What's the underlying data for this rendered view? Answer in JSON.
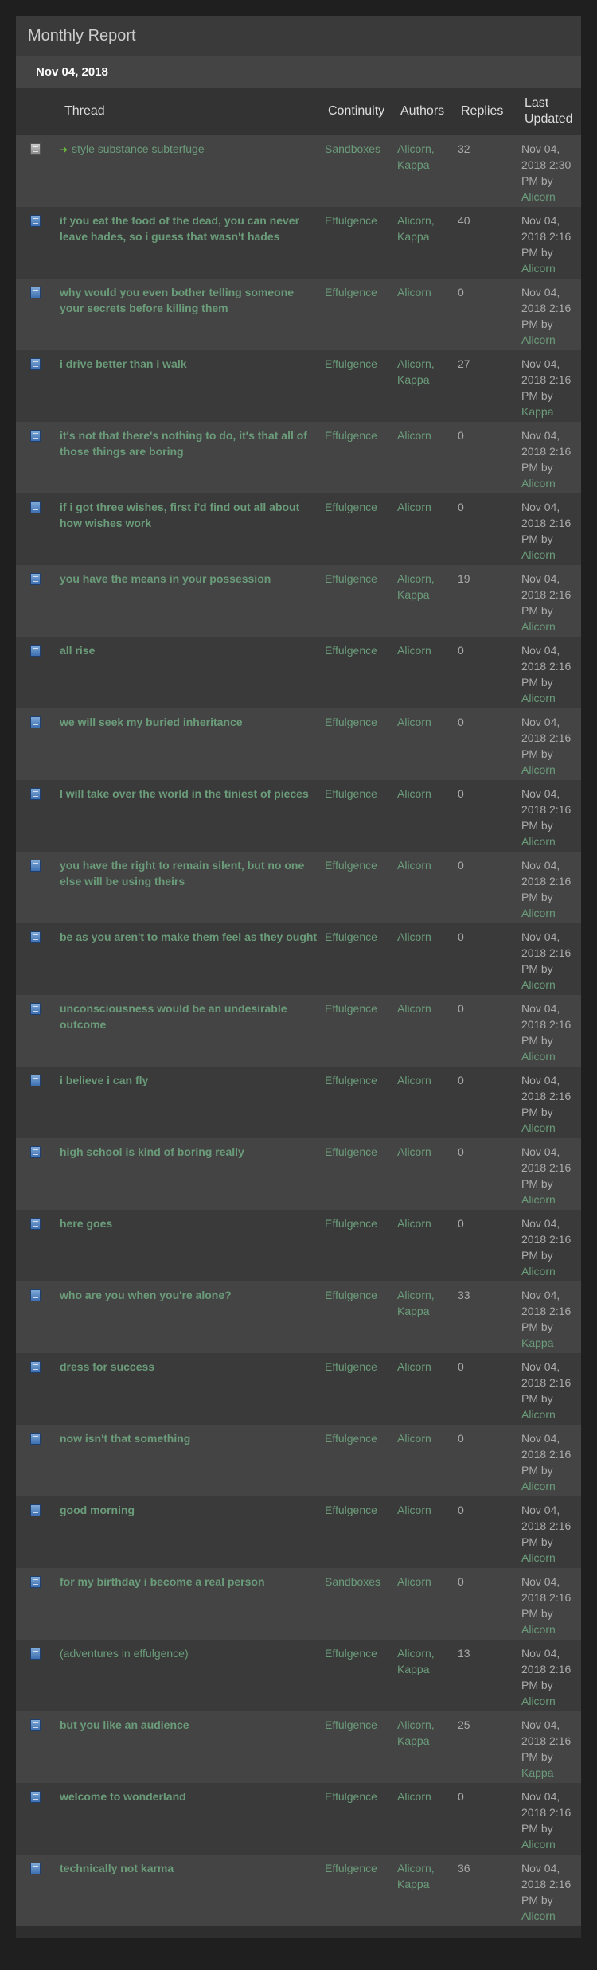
{
  "header": {
    "title": "Monthly Report",
    "date": "Nov 04, 2018"
  },
  "columns": {
    "thread": "Thread",
    "continuity": "Continuity",
    "authors": "Authors",
    "replies": "Replies",
    "last_updated": "Last Updated"
  },
  "colors": {
    "background": "#1f1f1f",
    "panel": "#2e2e2e",
    "link": "#6b9c7a",
    "row_odd": "#444444",
    "row_even": "#3a3a3a"
  },
  "rows": [
    {
      "icon": "doc-grey-icon",
      "arrow": true,
      "bold": false,
      "title": "style substance subterfuge",
      "continuity": "Sandboxes",
      "authors": "Alicorn, Kappa",
      "replies": "32",
      "updated_date": "Nov 04, 2018 2:30 PM by",
      "updated_by": "Alicorn"
    },
    {
      "icon": "doc-blue-icon",
      "arrow": false,
      "bold": true,
      "title": "if you eat the food of the dead, you can never leave hades, so i guess that wasn't hades",
      "continuity": "Effulgence",
      "authors": "Alicorn, Kappa",
      "replies": "40",
      "updated_date": "Nov 04, 2018 2:16 PM by",
      "updated_by": "Alicorn"
    },
    {
      "icon": "doc-blue-icon",
      "arrow": false,
      "bold": true,
      "title": "why would you even bother telling someone your secrets before killing them",
      "continuity": "Effulgence",
      "authors": "Alicorn",
      "replies": "0",
      "updated_date": "Nov 04, 2018 2:16 PM by",
      "updated_by": "Alicorn"
    },
    {
      "icon": "doc-blue-icon",
      "arrow": false,
      "bold": true,
      "title": "i drive better than i walk",
      "continuity": "Effulgence",
      "authors": "Alicorn, Kappa",
      "replies": "27",
      "updated_date": "Nov 04, 2018 2:16 PM by",
      "updated_by": "Kappa"
    },
    {
      "icon": "doc-blue-icon",
      "arrow": false,
      "bold": true,
      "title": "it's not that there's nothing to do, it's that all of those things are boring",
      "continuity": "Effulgence",
      "authors": "Alicorn",
      "replies": "0",
      "updated_date": "Nov 04, 2018 2:16 PM by",
      "updated_by": "Alicorn"
    },
    {
      "icon": "doc-blue-icon",
      "arrow": false,
      "bold": true,
      "title": "if i got three wishes, first i'd find out all about how wishes work",
      "continuity": "Effulgence",
      "authors": "Alicorn",
      "replies": "0",
      "updated_date": "Nov 04, 2018 2:16 PM by",
      "updated_by": "Alicorn"
    },
    {
      "icon": "doc-blue-icon",
      "arrow": false,
      "bold": true,
      "title": "you have the means in your possession",
      "continuity": "Effulgence",
      "authors": "Alicorn, Kappa",
      "replies": "19",
      "updated_date": "Nov 04, 2018 2:16 PM by",
      "updated_by": "Alicorn"
    },
    {
      "icon": "doc-blue-icon",
      "arrow": false,
      "bold": true,
      "title": "all rise",
      "continuity": "Effulgence",
      "authors": "Alicorn",
      "replies": "0",
      "updated_date": "Nov 04, 2018 2:16 PM by",
      "updated_by": "Alicorn"
    },
    {
      "icon": "doc-blue-icon",
      "arrow": false,
      "bold": true,
      "title": "we will seek my buried inheritance",
      "continuity": "Effulgence",
      "authors": "Alicorn",
      "replies": "0",
      "updated_date": "Nov 04, 2018 2:16 PM by",
      "updated_by": "Alicorn"
    },
    {
      "icon": "doc-blue-icon",
      "arrow": false,
      "bold": true,
      "title": "I will take over the world in the tiniest of pieces",
      "continuity": "Effulgence",
      "authors": "Alicorn",
      "replies": "0",
      "updated_date": "Nov 04, 2018 2:16 PM by",
      "updated_by": "Alicorn"
    },
    {
      "icon": "doc-blue-icon",
      "arrow": false,
      "bold": true,
      "title": "you have the right to remain silent, but no one else will be using theirs",
      "continuity": "Effulgence",
      "authors": "Alicorn",
      "replies": "0",
      "updated_date": "Nov 04, 2018 2:16 PM by",
      "updated_by": "Alicorn"
    },
    {
      "icon": "doc-blue-icon",
      "arrow": false,
      "bold": true,
      "title": "be as you aren't to make them feel as they ought",
      "continuity": "Effulgence",
      "authors": "Alicorn",
      "replies": "0",
      "updated_date": "Nov 04, 2018 2:16 PM by",
      "updated_by": "Alicorn"
    },
    {
      "icon": "doc-blue-icon",
      "arrow": false,
      "bold": true,
      "title": "unconsciousness would be an undesirable outcome",
      "continuity": "Effulgence",
      "authors": "Alicorn",
      "replies": "0",
      "updated_date": "Nov 04, 2018 2:16 PM by",
      "updated_by": "Alicorn"
    },
    {
      "icon": "doc-blue-icon",
      "arrow": false,
      "bold": true,
      "title": "i believe i can fly",
      "continuity": "Effulgence",
      "authors": "Alicorn",
      "replies": "0",
      "updated_date": "Nov 04, 2018 2:16 PM by",
      "updated_by": "Alicorn"
    },
    {
      "icon": "doc-blue-icon",
      "arrow": false,
      "bold": true,
      "title": "high school is kind of boring really",
      "continuity": "Effulgence",
      "authors": "Alicorn",
      "replies": "0",
      "updated_date": "Nov 04, 2018 2:16 PM by",
      "updated_by": "Alicorn"
    },
    {
      "icon": "doc-blue-icon",
      "arrow": false,
      "bold": true,
      "title": "here goes",
      "continuity": "Effulgence",
      "authors": "Alicorn",
      "replies": "0",
      "updated_date": "Nov 04, 2018 2:16 PM by",
      "updated_by": "Alicorn"
    },
    {
      "icon": "doc-blue-icon",
      "arrow": false,
      "bold": true,
      "title": "who are you when you're alone?",
      "continuity": "Effulgence",
      "authors": "Alicorn, Kappa",
      "replies": "33",
      "updated_date": "Nov 04, 2018 2:16 PM by",
      "updated_by": "Kappa"
    },
    {
      "icon": "doc-blue-icon",
      "arrow": false,
      "bold": true,
      "title": "dress for success",
      "continuity": "Effulgence",
      "authors": "Alicorn",
      "replies": "0",
      "updated_date": "Nov 04, 2018 2:16 PM by",
      "updated_by": "Alicorn"
    },
    {
      "icon": "doc-blue-icon",
      "arrow": false,
      "bold": true,
      "title": "now isn't that something",
      "continuity": "Effulgence",
      "authors": "Alicorn",
      "replies": "0",
      "updated_date": "Nov 04, 2018 2:16 PM by",
      "updated_by": "Alicorn"
    },
    {
      "icon": "doc-blue-icon",
      "arrow": false,
      "bold": true,
      "title": "good morning",
      "continuity": "Effulgence",
      "authors": "Alicorn",
      "replies": "0",
      "updated_date": "Nov 04, 2018 2:16 PM by",
      "updated_by": "Alicorn"
    },
    {
      "icon": "doc-blue-icon",
      "arrow": false,
      "bold": true,
      "title": "for my birthday i become a real person",
      "continuity": "Sandboxes",
      "authors": "Alicorn",
      "replies": "0",
      "updated_date": "Nov 04, 2018 2:16 PM by",
      "updated_by": "Alicorn"
    },
    {
      "icon": "doc-blue-icon",
      "arrow": false,
      "bold": false,
      "title": "(adventures in effulgence)",
      "continuity": "Effulgence",
      "authors": "Alicorn, Kappa",
      "replies": "13",
      "updated_date": "Nov 04, 2018 2:16 PM by",
      "updated_by": "Alicorn"
    },
    {
      "icon": "doc-blue-icon",
      "arrow": false,
      "bold": true,
      "title": "but you like an audience",
      "continuity": "Effulgence",
      "authors": "Alicorn, Kappa",
      "replies": "25",
      "updated_date": "Nov 04, 2018 2:16 PM by",
      "updated_by": "Kappa"
    },
    {
      "icon": "doc-blue-icon",
      "arrow": false,
      "bold": true,
      "title": "welcome to wonderland",
      "continuity": "Effulgence",
      "authors": "Alicorn",
      "replies": "0",
      "updated_date": "Nov 04, 2018 2:16 PM by",
      "updated_by": "Alicorn"
    },
    {
      "icon": "doc-blue-icon",
      "arrow": false,
      "bold": true,
      "title": "technically not karma",
      "continuity": "Effulgence",
      "authors": "Alicorn, Kappa",
      "replies": "36",
      "updated_date": "Nov 04, 2018 2:16 PM by",
      "updated_by": "Alicorn"
    }
  ]
}
